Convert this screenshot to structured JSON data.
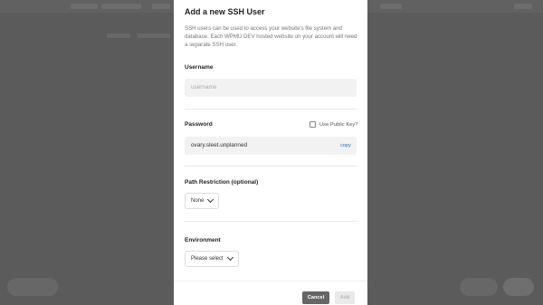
{
  "modal": {
    "title": "Add a new SSH User",
    "description": "SSH users can be used to access your website's file system and database. Each WPMU DEV hosted website on your account will need a separate SSH user."
  },
  "username": {
    "label": "Username",
    "placeholder": "username"
  },
  "password": {
    "label": "Password",
    "public_key_label": "Use Public Key?",
    "value": "ovary.sleet.unplanned",
    "copy_label": "copy"
  },
  "path_restriction": {
    "label": "Path Restriction (optional)",
    "selected": "None"
  },
  "environment": {
    "label": "Environment",
    "selected": "Please select"
  },
  "buttons": {
    "cancel": "Cancel",
    "add": "Add"
  },
  "colors": {
    "overlay": "#5e5e5e",
    "modal_bg": "#ffffff",
    "field_bg": "#f2f2f2",
    "link": "#1a73d9",
    "cancel_bg": "#666666",
    "add_disabled_bg": "#e9e9e9"
  }
}
